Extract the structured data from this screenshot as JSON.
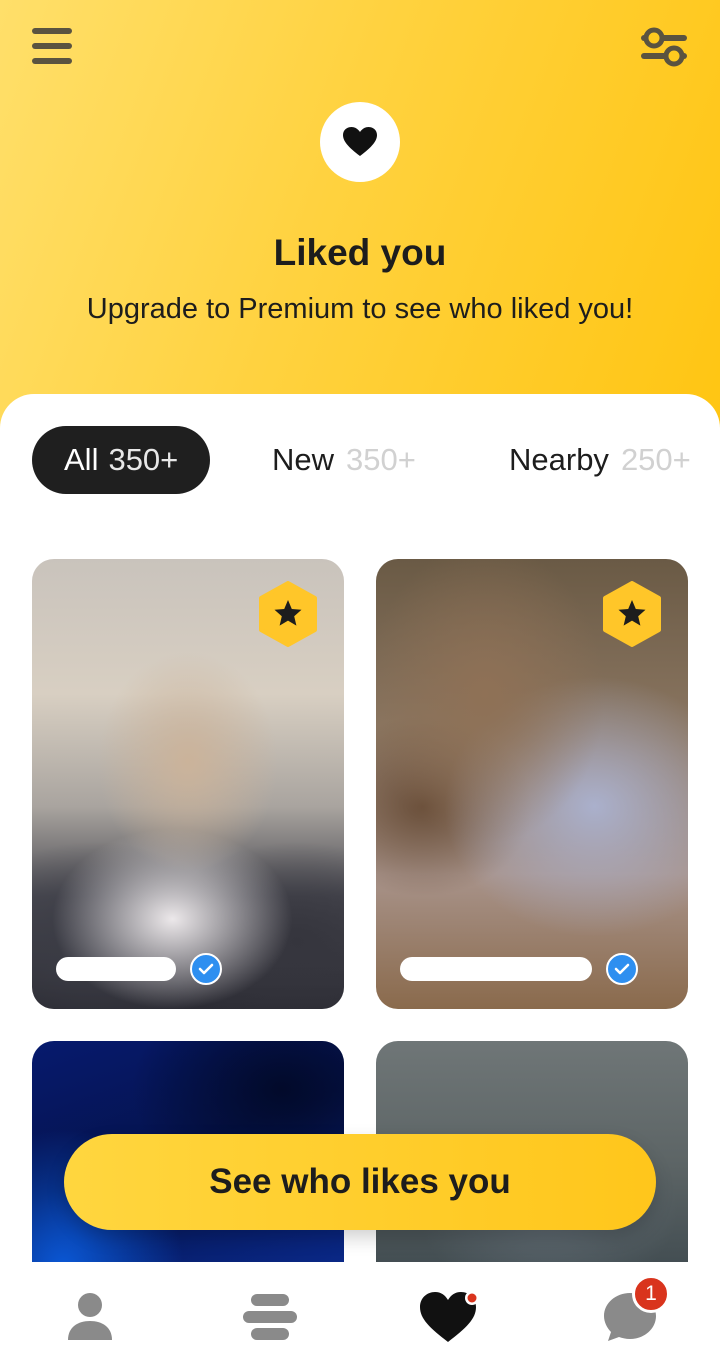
{
  "header": {
    "menu_icon": "hamburger-menu-icon",
    "filter_icon": "sliders-filter-icon",
    "heart_icon": "heart-icon",
    "title": "Liked you",
    "subtitle": "Upgrade to Premium to see who liked you!"
  },
  "tabs": [
    {
      "label": "All",
      "count": "350+",
      "active": true
    },
    {
      "label": "New",
      "count": "350+",
      "active": false
    },
    {
      "label": "Nearby",
      "count": "250+",
      "active": false
    }
  ],
  "cards": [
    {
      "premium_badge": "star-hexagon-icon",
      "verified": true
    },
    {
      "premium_badge": "star-hexagon-icon",
      "verified": true
    },
    {
      "verified": false
    },
    {
      "verified": false
    }
  ],
  "cta": {
    "label": "See who likes you"
  },
  "bottom_nav": {
    "items": [
      {
        "icon": "profile-icon"
      },
      {
        "icon": "discover-stack-icon"
      },
      {
        "icon": "liked-you-heart-icon",
        "active": true
      },
      {
        "icon": "chat-icon",
        "badge": "1"
      }
    ]
  },
  "colors": {
    "brand_yellow": "#ffc629",
    "dark": "#1f1f1f",
    "verify_blue": "#2e8ff0",
    "notification_red": "#d9341d"
  }
}
